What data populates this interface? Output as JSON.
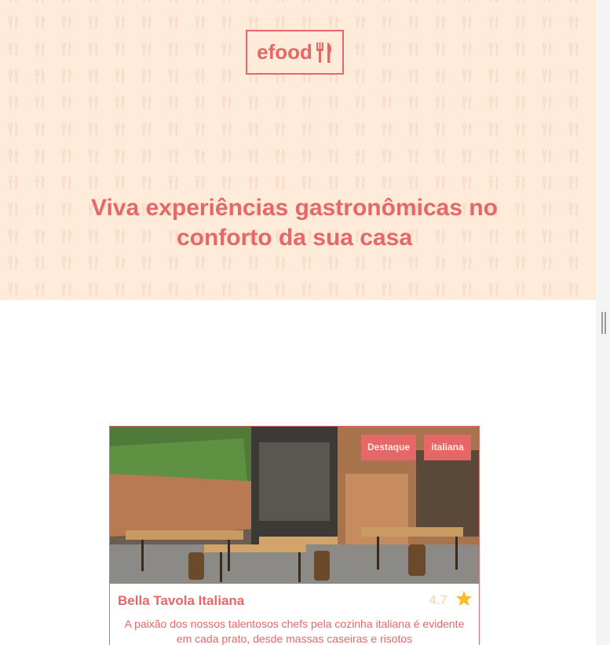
{
  "header": {
    "logo_text": "efood",
    "logo_icon": "fork-knife-icon",
    "headline": "Viva experiências gastronômicas no conforto da sua casa"
  },
  "restaurants": [
    {
      "name": "Bella Tavola Italiana",
      "rating": "4.7",
      "rating_icon": "star-icon",
      "tags": [
        "Destaque",
        "italiana"
      ],
      "description": "A paixão dos nossos talentosos chefs pela cozinha italiana é evidente em cada prato, desde massas caseiras e risotos"
    }
  ],
  "colors": {
    "primary": "#E66767",
    "hero_background": "#FFEBD9",
    "star": "#FFB930",
    "rating_text": "#F7DFC3"
  }
}
